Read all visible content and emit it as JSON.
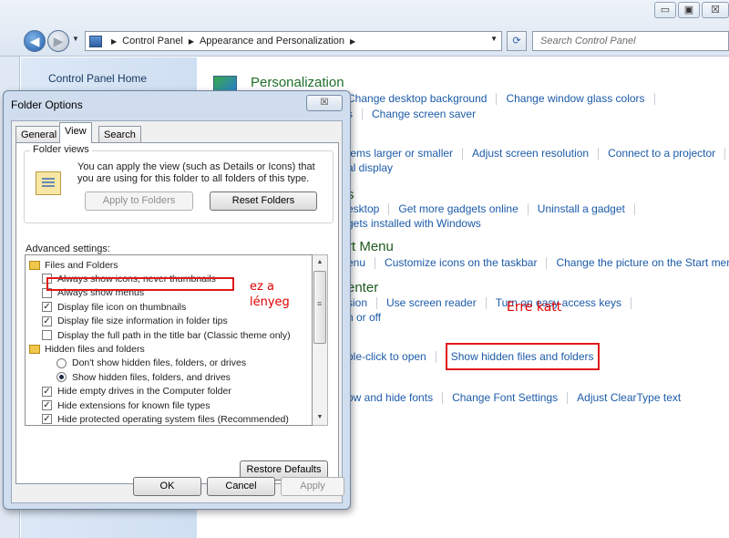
{
  "window": {
    "caption_minimize": "▭",
    "caption_maximize": "▣",
    "caption_close": "☒",
    "address_crumbs": [
      "Control Panel",
      "Appearance and Personalization"
    ],
    "search_placeholder": "Search Control Panel"
  },
  "left_pane": {
    "home_link": "Control Panel Home"
  },
  "main": {
    "personalization_title": "Personalization",
    "personalization_links_1": [
      "Change desktop background",
      "Change window glass colors"
    ],
    "personalization_links_2_partial": "s",
    "personalization_links_2": [
      "Change screen saver"
    ],
    "display_partial": "tems larger or smaller",
    "display_links": [
      "Adjust screen resolution",
      "Connect to a projector"
    ],
    "display_partial_2": "al display",
    "gadgets_title_partial": "s",
    "gadgets_partial": "esktop",
    "gadgets_links": [
      "Get more gadgets online",
      "Uninstall a gadget"
    ],
    "gadgets_partial_2": "gets installed with Windows",
    "startmenu_title_partial": "rt Menu",
    "startmenu_partial": "enu",
    "startmenu_links": [
      "Customize icons on the taskbar",
      "Change the picture on the Start menu"
    ],
    "center_title_partial": "enter",
    "center_partial": "sion",
    "center_links": [
      "Use screen reader",
      "Turn on easy access keys"
    ],
    "center_partial_2": "n or off",
    "folder_partial": "ble-click to open",
    "show_hidden_link": "Show hidden files and folders",
    "fonts_partial": "ow and hide fonts",
    "fonts_links": [
      "Change Font Settings",
      "Adjust ClearType text"
    ]
  },
  "annotations": {
    "erre_katt": "Erre katt",
    "ez_a_lenyeg_1": "ez a",
    "ez_a_lenyeg_2": "lényeg"
  },
  "dialog": {
    "title": "Folder Options",
    "close_label": "☒",
    "tabs": [
      "General",
      "View",
      "Search"
    ],
    "active_tab": "View",
    "folder_views_legend": "Folder views",
    "folder_views_desc": "You can apply the view (such as Details or Icons) that you are using for this folder to all folders of this type.",
    "apply_to_folders": "Apply to Folders",
    "reset_folders": "Reset Folders",
    "advanced_label": "Advanced settings:",
    "tree": [
      {
        "type": "folder",
        "label": "Files and Folders"
      },
      {
        "type": "checkbox",
        "checked": false,
        "label": "Always show icons, never thumbnails"
      },
      {
        "type": "checkbox",
        "checked": false,
        "label": "Always show menus"
      },
      {
        "type": "checkbox",
        "checked": true,
        "label": "Display file icon on thumbnails"
      },
      {
        "type": "checkbox",
        "checked": true,
        "label": "Display file size information in folder tips"
      },
      {
        "type": "checkbox",
        "checked": false,
        "label": "Display the full path in the title bar (Classic theme only)"
      },
      {
        "type": "folder",
        "label": "Hidden files and folders"
      },
      {
        "type": "radio",
        "checked": false,
        "label": "Don't show hidden files, folders, or drives"
      },
      {
        "type": "radio",
        "checked": true,
        "label": "Show hidden files, folders, and drives"
      },
      {
        "type": "checkbox",
        "checked": true,
        "label": "Hide empty drives in the Computer folder"
      },
      {
        "type": "checkbox",
        "checked": true,
        "label": "Hide extensions for known file types"
      },
      {
        "type": "checkbox",
        "checked": true,
        "label": "Hide protected operating system files (Recommended)"
      }
    ],
    "restore_defaults": "Restore Defaults",
    "ok": "OK",
    "cancel": "Cancel",
    "apply": "Apply"
  },
  "colors": {
    "link": "#1c5ba8",
    "annotation_red": "#e00000"
  }
}
